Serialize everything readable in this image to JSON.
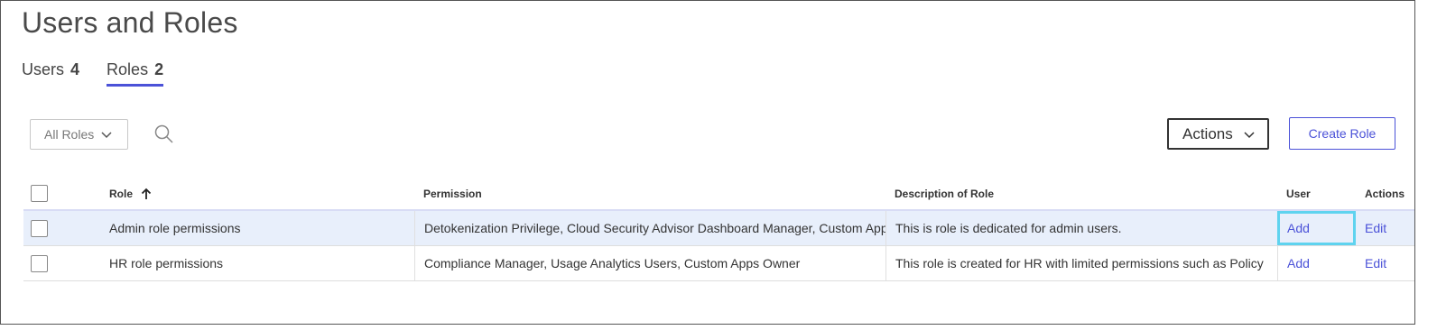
{
  "page": {
    "title": "Users and Roles"
  },
  "tabs": [
    {
      "label": "Users",
      "count": "4",
      "active": false
    },
    {
      "label": "Roles",
      "count": "2",
      "active": true
    }
  ],
  "toolbar": {
    "filter_value": "All Roles",
    "actions_label": "Actions",
    "create_label": "Create Role"
  },
  "table": {
    "columns": {
      "role": "Role",
      "permission": "Permission",
      "description": "Description of Role",
      "user": "User",
      "actions": "Actions"
    },
    "sort": {
      "column": "role",
      "direction": "ascending"
    },
    "rows": [
      {
        "role": "Admin role permissions",
        "permission": "Detokenization Privilege, Cloud Security Advisor Dashboard Manager, Custom Apps Owner",
        "description": "This is role is dedicated for admin users.",
        "user_link": "Add",
        "action_link": "Edit",
        "selected": true
      },
      {
        "role": "HR role permissions",
        "permission": "Compliance Manager, Usage Analytics Users, Custom Apps Owner",
        "description": "This role is created for HR with limited permissions such as Policy",
        "user_link": "Add",
        "action_link": "Edit",
        "selected": false
      }
    ]
  },
  "colors": {
    "accent": "#4b52d8",
    "focus": "#5fd3ef",
    "selected_row": "#e8effb"
  }
}
